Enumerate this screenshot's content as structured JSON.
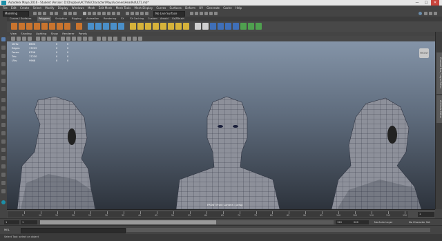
{
  "window": {
    "title": "Autodesk Maya 2016 - Student Version: D:\\Dropbox\\ACTIVE\\Character\\Maya\\scenes\\HeadAdULT1.mb*",
    "minimize": "—",
    "maximize": "□",
    "close": "✕"
  },
  "menubar": [
    "File",
    "Edit",
    "Create",
    "Select",
    "Modify",
    "Display",
    "Windows",
    "Mesh",
    "Edit Mesh",
    "Mesh Tools",
    "Mesh Display",
    "Curves",
    "Surfaces",
    "Deform",
    "UV",
    "Generate",
    "Cache",
    "Help"
  ],
  "statusline": {
    "mode": "Modeling",
    "live_surface": "No Live Surface",
    "user_icon": "user-icon"
  },
  "shelf_tabs": [
    {
      "label": "Curves / Surfaces",
      "active": false
    },
    {
      "label": "Polygons",
      "active": true
    },
    {
      "label": "Sculpting",
      "active": false
    },
    {
      "label": "Rigging",
      "active": false
    },
    {
      "label": "Animation",
      "active": false
    },
    {
      "label": "Rendering",
      "active": false
    },
    {
      "label": "FX",
      "active": false
    },
    {
      "label": "FX Caching",
      "active": false
    },
    {
      "label": "Custom",
      "active": false
    },
    {
      "label": "Arnold",
      "active": false
    },
    {
      "label": "GoZBrush",
      "active": false
    }
  ],
  "panel_menu": [
    "View",
    "Shading",
    "Lighting",
    "Show",
    "Renderer",
    "Panels"
  ],
  "hud": {
    "rows": [
      {
        "label": "Verts:",
        "value": "8604",
        "a": "0",
        "b": "0"
      },
      {
        "label": "Edges:",
        "value": "17229",
        "a": "0",
        "b": "0"
      },
      {
        "label": "Faces:",
        "value": "8706",
        "a": "0",
        "b": "0"
      },
      {
        "label": "Tris:",
        "value": "17230",
        "a": "0",
        "b": "0"
      },
      {
        "label": "UVs:",
        "value": "9968",
        "a": "0",
        "b": "0"
      }
    ]
  },
  "viewport": {
    "camera_label": "FRONT Front Camera : persp",
    "viewcube_label": "FRONT"
  },
  "channel_strip": {
    "tab1": "Channel Box / Layer Editor",
    "tab2": "Attribute Editor"
  },
  "timeline": {
    "ticks": [
      "5",
      "10",
      "15",
      "20",
      "25",
      "30",
      "35",
      "40",
      "45",
      "50",
      "55",
      "60",
      "65",
      "70",
      "75",
      "80",
      "85",
      "90",
      "95",
      "100",
      "105",
      "110",
      "115",
      "120"
    ],
    "current_frame": "1"
  },
  "range": {
    "start": "1",
    "playback_start": "1",
    "playback_end": "120",
    "end": "120",
    "anim_end": "200",
    "anim_layer": "No Anim Layer",
    "character_set": "No Character Set",
    "playback_fraction": 0.6
  },
  "command_line": {
    "label": "MEL"
  },
  "help_line": "Select Tool: select an object",
  "colors": {
    "accent": "#1d8fa8",
    "active_tab": "#5d5d5d",
    "viewport_top": "#8494a8",
    "viewport_bottom": "#2d333c"
  }
}
